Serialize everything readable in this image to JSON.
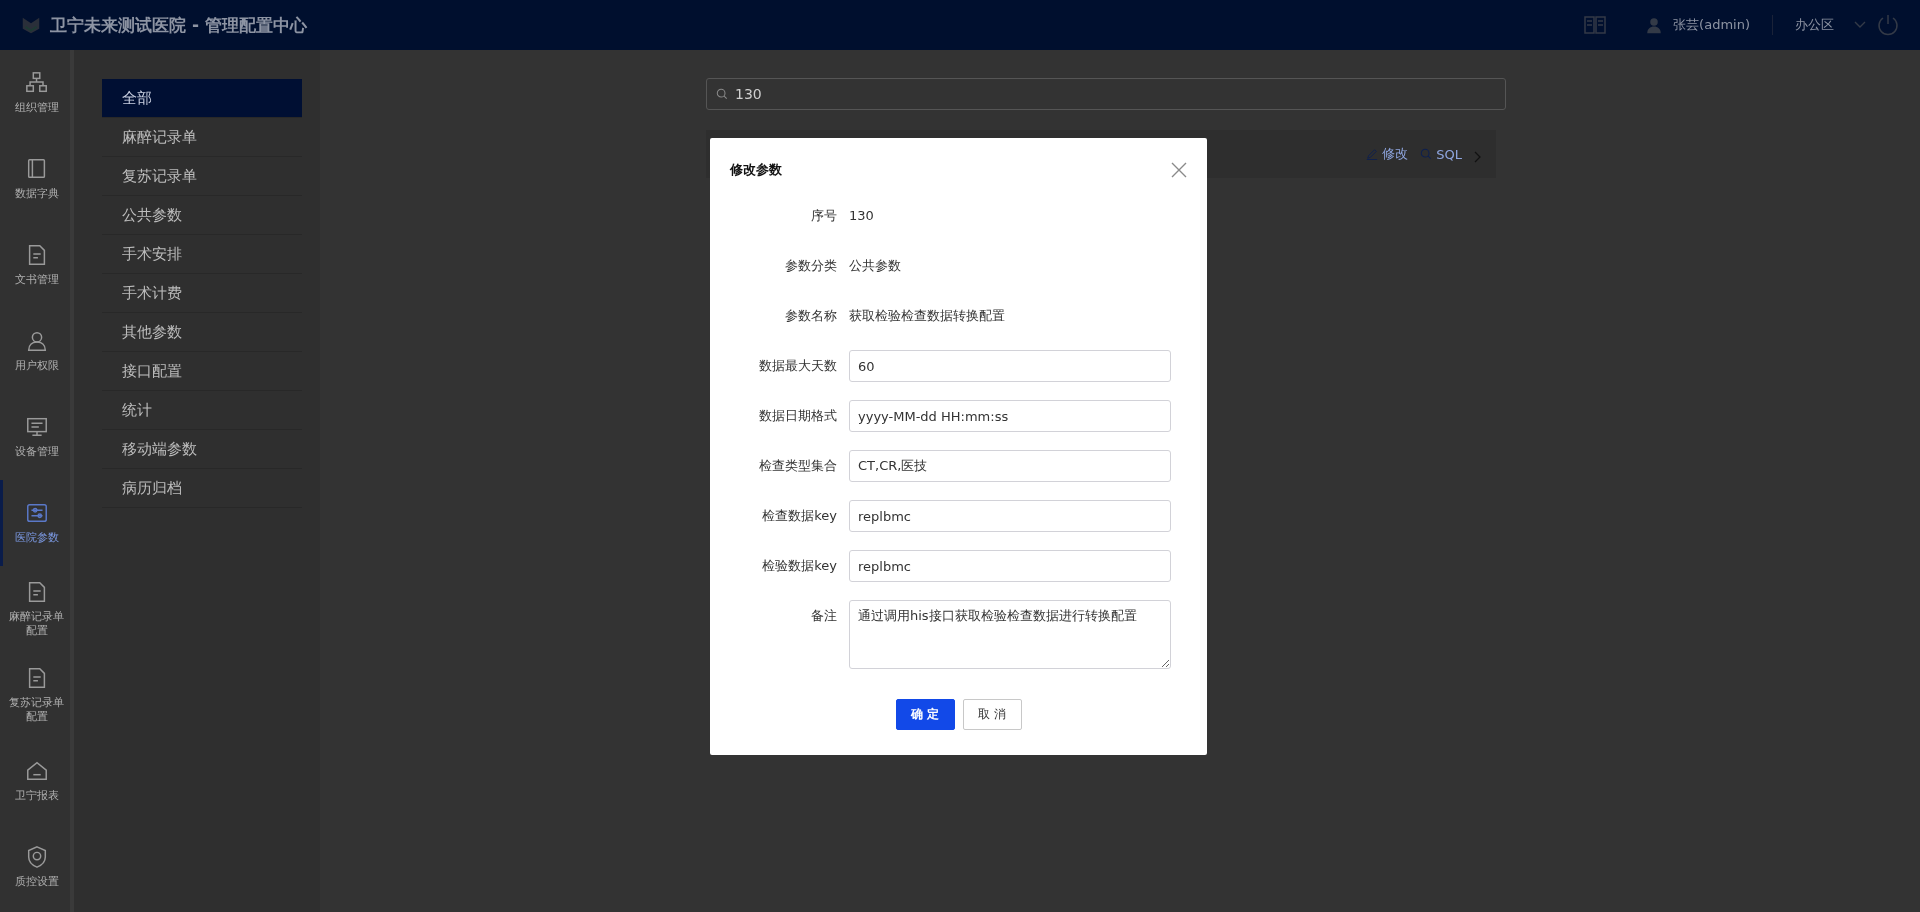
{
  "header": {
    "title": "卫宁未来测试医院 - 管理配置中心",
    "user": "张芸(admin)",
    "area": "办公区"
  },
  "rail": [
    {
      "label": "组织管理",
      "kind": "org",
      "selected": false
    },
    {
      "label": "数据字典",
      "kind": "book",
      "selected": false
    },
    {
      "label": "文书管理",
      "kind": "doc",
      "selected": false
    },
    {
      "label": "用户权限",
      "kind": "user",
      "selected": false
    },
    {
      "label": "设备管理",
      "kind": "monitor",
      "selected": false
    },
    {
      "label": "医院参数",
      "kind": "sliders",
      "selected": true
    },
    {
      "label": "麻醉记录单配置",
      "kind": "doc",
      "selected": false
    },
    {
      "label": "复苏记录单配置",
      "kind": "doc",
      "selected": false
    },
    {
      "label": "卫宁报表",
      "kind": "home",
      "selected": false
    },
    {
      "label": "质控设置",
      "kind": "shield",
      "selected": false
    }
  ],
  "categories": [
    {
      "label": "全部",
      "selected": true
    },
    {
      "label": "麻醉记录单",
      "selected": false
    },
    {
      "label": "复苏记录单",
      "selected": false
    },
    {
      "label": "公共参数",
      "selected": false
    },
    {
      "label": "手术安排",
      "selected": false
    },
    {
      "label": "手术计费",
      "selected": false
    },
    {
      "label": "其他参数",
      "selected": false
    },
    {
      "label": "接口配置",
      "selected": false
    },
    {
      "label": "统计",
      "selected": false
    },
    {
      "label": "移动端参数",
      "selected": false
    },
    {
      "label": "病历归档",
      "selected": false
    }
  ],
  "search": {
    "value": "130"
  },
  "row_actions": [
    {
      "label": "修改",
      "kind": "edit"
    },
    {
      "label": "SQL",
      "kind": "sql"
    }
  ],
  "dialog": {
    "title": "修改参数",
    "fields": [
      {
        "label": "序号",
        "kind": "text",
        "value": "130"
      },
      {
        "label": "参数分类",
        "kind": "text",
        "value": "公共参数"
      },
      {
        "label": "参数名称",
        "kind": "text",
        "value": "获取检验检查数据转换配置"
      },
      {
        "label": "数据最大天数",
        "kind": "input",
        "value": "60"
      },
      {
        "label": "数据日期格式",
        "kind": "input",
        "value": "yyyy-MM-dd HH:mm:ss"
      },
      {
        "label": "检查类型集合",
        "kind": "input",
        "value": "CT,CR,医技"
      },
      {
        "label": "检查数据key",
        "kind": "input",
        "value": "replbmc"
      },
      {
        "label": "检验数据key",
        "kind": "input",
        "value": "replbmc"
      },
      {
        "label": "备注",
        "kind": "textarea",
        "value": "通过调用his接口获取检验检查数据进行转换配置"
      }
    ],
    "buttons": [
      {
        "label": "确 定",
        "kind": "primary"
      },
      {
        "label": "取 消",
        "kind": "default"
      }
    ]
  }
}
